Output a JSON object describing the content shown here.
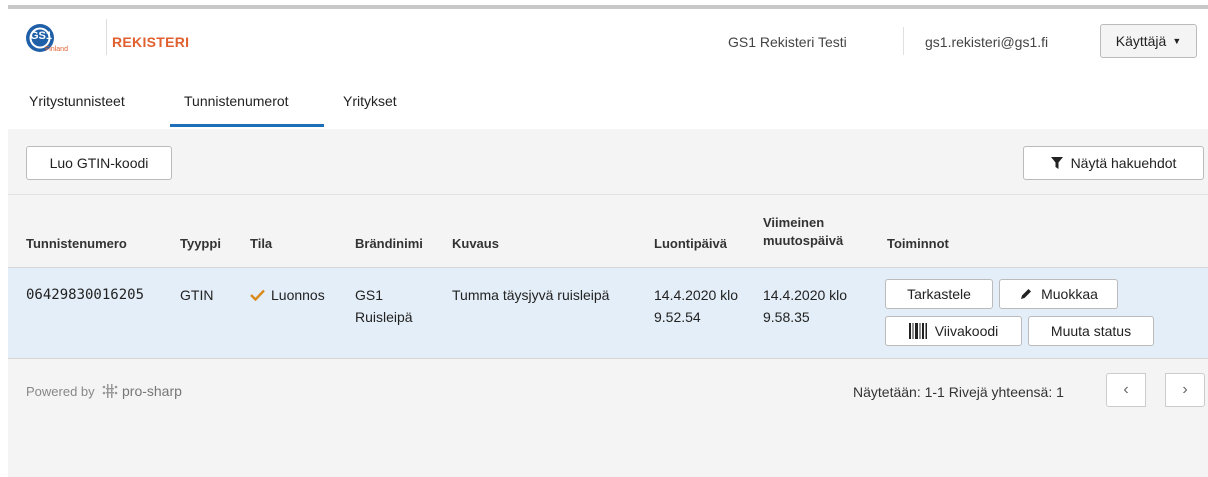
{
  "header": {
    "logo_text": "GS1",
    "logo_subtext": "Finland",
    "brand": "REKISTERI",
    "environment": "GS1 Rekisteri Testi",
    "email": "gs1.rekisteri@gs1.fi",
    "user_menu": "Käyttäjä"
  },
  "tabs": [
    {
      "label": "Yritystunnisteet"
    },
    {
      "label": "Tunnistenumerot",
      "active": true
    },
    {
      "label": "Yritykset"
    }
  ],
  "toolbar": {
    "create_label": "Luo GTIN-koodi",
    "filters_label": "Näytä hakuehdot"
  },
  "table": {
    "columns": [
      "Tunnistenumero",
      "Tyyppi",
      "Tila",
      "Brändinimi",
      "Kuvaus",
      "Luontipäivä",
      "Viimeinen muutospäivä",
      "Toiminnot"
    ],
    "rows": [
      {
        "number": "06429830016205",
        "type": "GTIN",
        "status": "Luonnos",
        "brand": "GS1 Ruisleipä",
        "description": "Tumma täysjyvä ruisleipä",
        "created": "14.4.2020 klo 9.52.54",
        "modified": "14.4.2020 klo 9.58.35",
        "actions": {
          "view": "Tarkastele",
          "edit": "Muokkaa",
          "barcode": "Viivakoodi",
          "change_status": "Muuta status"
        }
      }
    ]
  },
  "footer": {
    "powered_by": "Powered by",
    "provider": "pro-sharp",
    "pagination_info": "Näytetään: 1-1 Rivejä yhteensä: 1"
  },
  "colors": {
    "brand_orange": "#e06030",
    "gs1_blue": "#1f5fa8",
    "active_tab": "#1f6fb8",
    "row_highlight": "#e4eef8",
    "status_check": "#d98a1c"
  },
  "icons": {
    "filter": "filter-icon",
    "edit": "pencil-icon",
    "barcode": "barcode-icon",
    "status": "checkmark-icon",
    "prev": "chevron-left-icon",
    "next": "chevron-right-icon"
  }
}
